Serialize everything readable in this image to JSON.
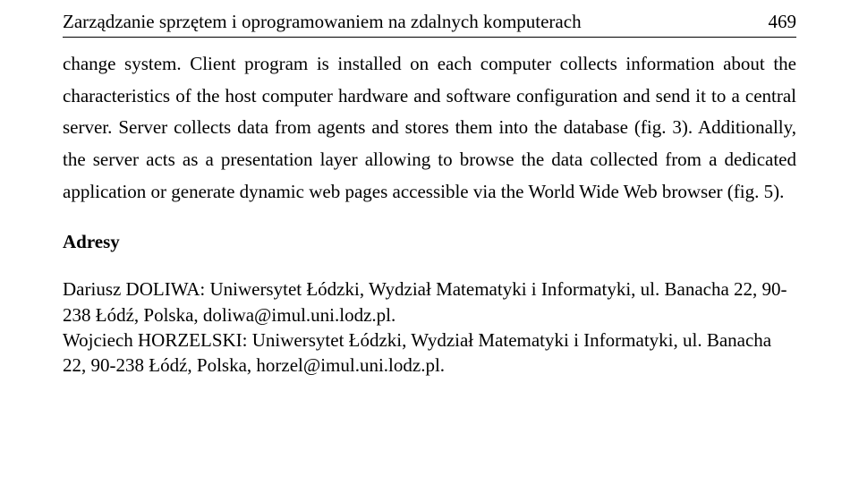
{
  "header": {
    "running_title": "Zarządzanie sprzętem i oprogramowaniem na zdalnych komputerach",
    "page_number": "469"
  },
  "body": {
    "paragraph": "change system. Client program is installed on each computer collects information about the characteristics of the host computer hardware and software configuration and send it to a central server. Server collects data from agents and stores them into the database (fig. 3). Additionally, the server acts as a presentation layer allowing to browse the data collected from a dedicated application or generate dynamic web pages accessible via the World Wide Web browser (fig. 5)."
  },
  "addresses": {
    "heading": "Adresy",
    "entries": [
      "Dariusz DOLIWA: Uniwersytet Łódzki, Wydział Matematyki i Informatyki, ul. Banacha 22, 90-238 Łódź, Polska, doliwa@imul.uni.lodz.pl.",
      "Wojciech HORZELSKI: Uniwersytet Łódzki, Wydział Matematyki i Informatyki, ul. Banacha 22, 90-238 Łódź, Polska, horzel@imul.uni.lodz.pl."
    ]
  }
}
